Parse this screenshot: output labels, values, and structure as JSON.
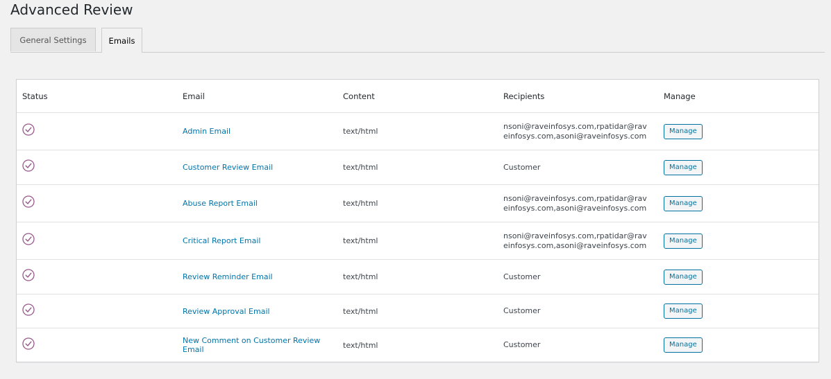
{
  "page": {
    "title": "Advanced Review"
  },
  "tabs": [
    {
      "label": "General Settings",
      "active": false
    },
    {
      "label": "Emails",
      "active": true
    }
  ],
  "table": {
    "headers": [
      "Status",
      "Email",
      "Content",
      "Recipients",
      "Manage"
    ],
    "rows": [
      {
        "status": "enabled",
        "email": "Admin Email",
        "content": "text/html",
        "recipients": "nsoni@raveinfosys.com,rpatidar@raveinfosys.com,asoni@raveinfosys.com",
        "manage": "Manage"
      },
      {
        "status": "enabled",
        "email": "Customer Review Email",
        "content": "text/html",
        "recipients": "Customer",
        "manage": "Manage"
      },
      {
        "status": "enabled",
        "email": "Abuse Report Email",
        "content": "text/html",
        "recipients": "nsoni@raveinfosys.com,rpatidar@raveinfosys.com,asoni@raveinfosys.com",
        "manage": "Manage"
      },
      {
        "status": "enabled",
        "email": "Critical Report Email",
        "content": "text/html",
        "recipients": "nsoni@raveinfosys.com,rpatidar@raveinfosys.com,asoni@raveinfosys.com",
        "manage": "Manage"
      },
      {
        "status": "enabled",
        "email": "Review Reminder Email",
        "content": "text/html",
        "recipients": "Customer",
        "manage": "Manage"
      },
      {
        "status": "enabled",
        "email": "Review Approval Email",
        "content": "text/html",
        "recipients": "Customer",
        "manage": "Manage"
      },
      {
        "status": "enabled",
        "email": "New Comment on Customer Review Email",
        "content": "text/html",
        "recipients": "Customer",
        "manage": "Manage"
      }
    ]
  },
  "icons": {
    "status": "check-circle-icon"
  },
  "colors": {
    "accent": "#0073aa",
    "status_check": "#96588a",
    "background": "#f1f1f1"
  }
}
